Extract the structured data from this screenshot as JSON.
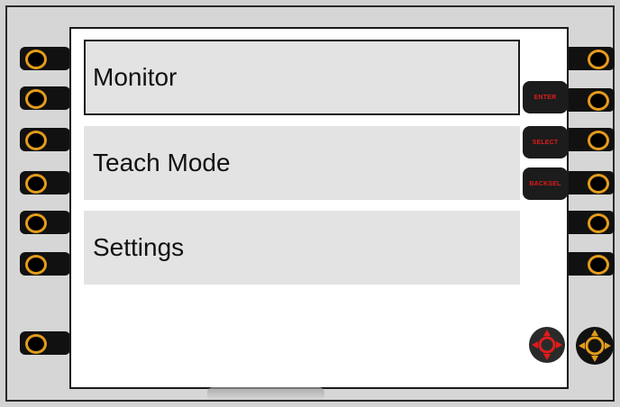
{
  "menu": {
    "items": [
      {
        "label": "Monitor",
        "selected": true
      },
      {
        "label": "Teach Mode",
        "selected": false
      },
      {
        "label": "Settings",
        "selected": false
      }
    ]
  },
  "soft_buttons": {
    "enter_label": "ENTER",
    "select_label": "SELECT",
    "backsel_label": "BACKSEL"
  },
  "colors": {
    "ring": "#e39b1c",
    "soft_button_text": "#e01b1b",
    "menu_item_bg": "#e3e3e3"
  },
  "icons": {
    "dpad_red": "dpad-icon",
    "dpad_orange": "dpad-icon"
  }
}
